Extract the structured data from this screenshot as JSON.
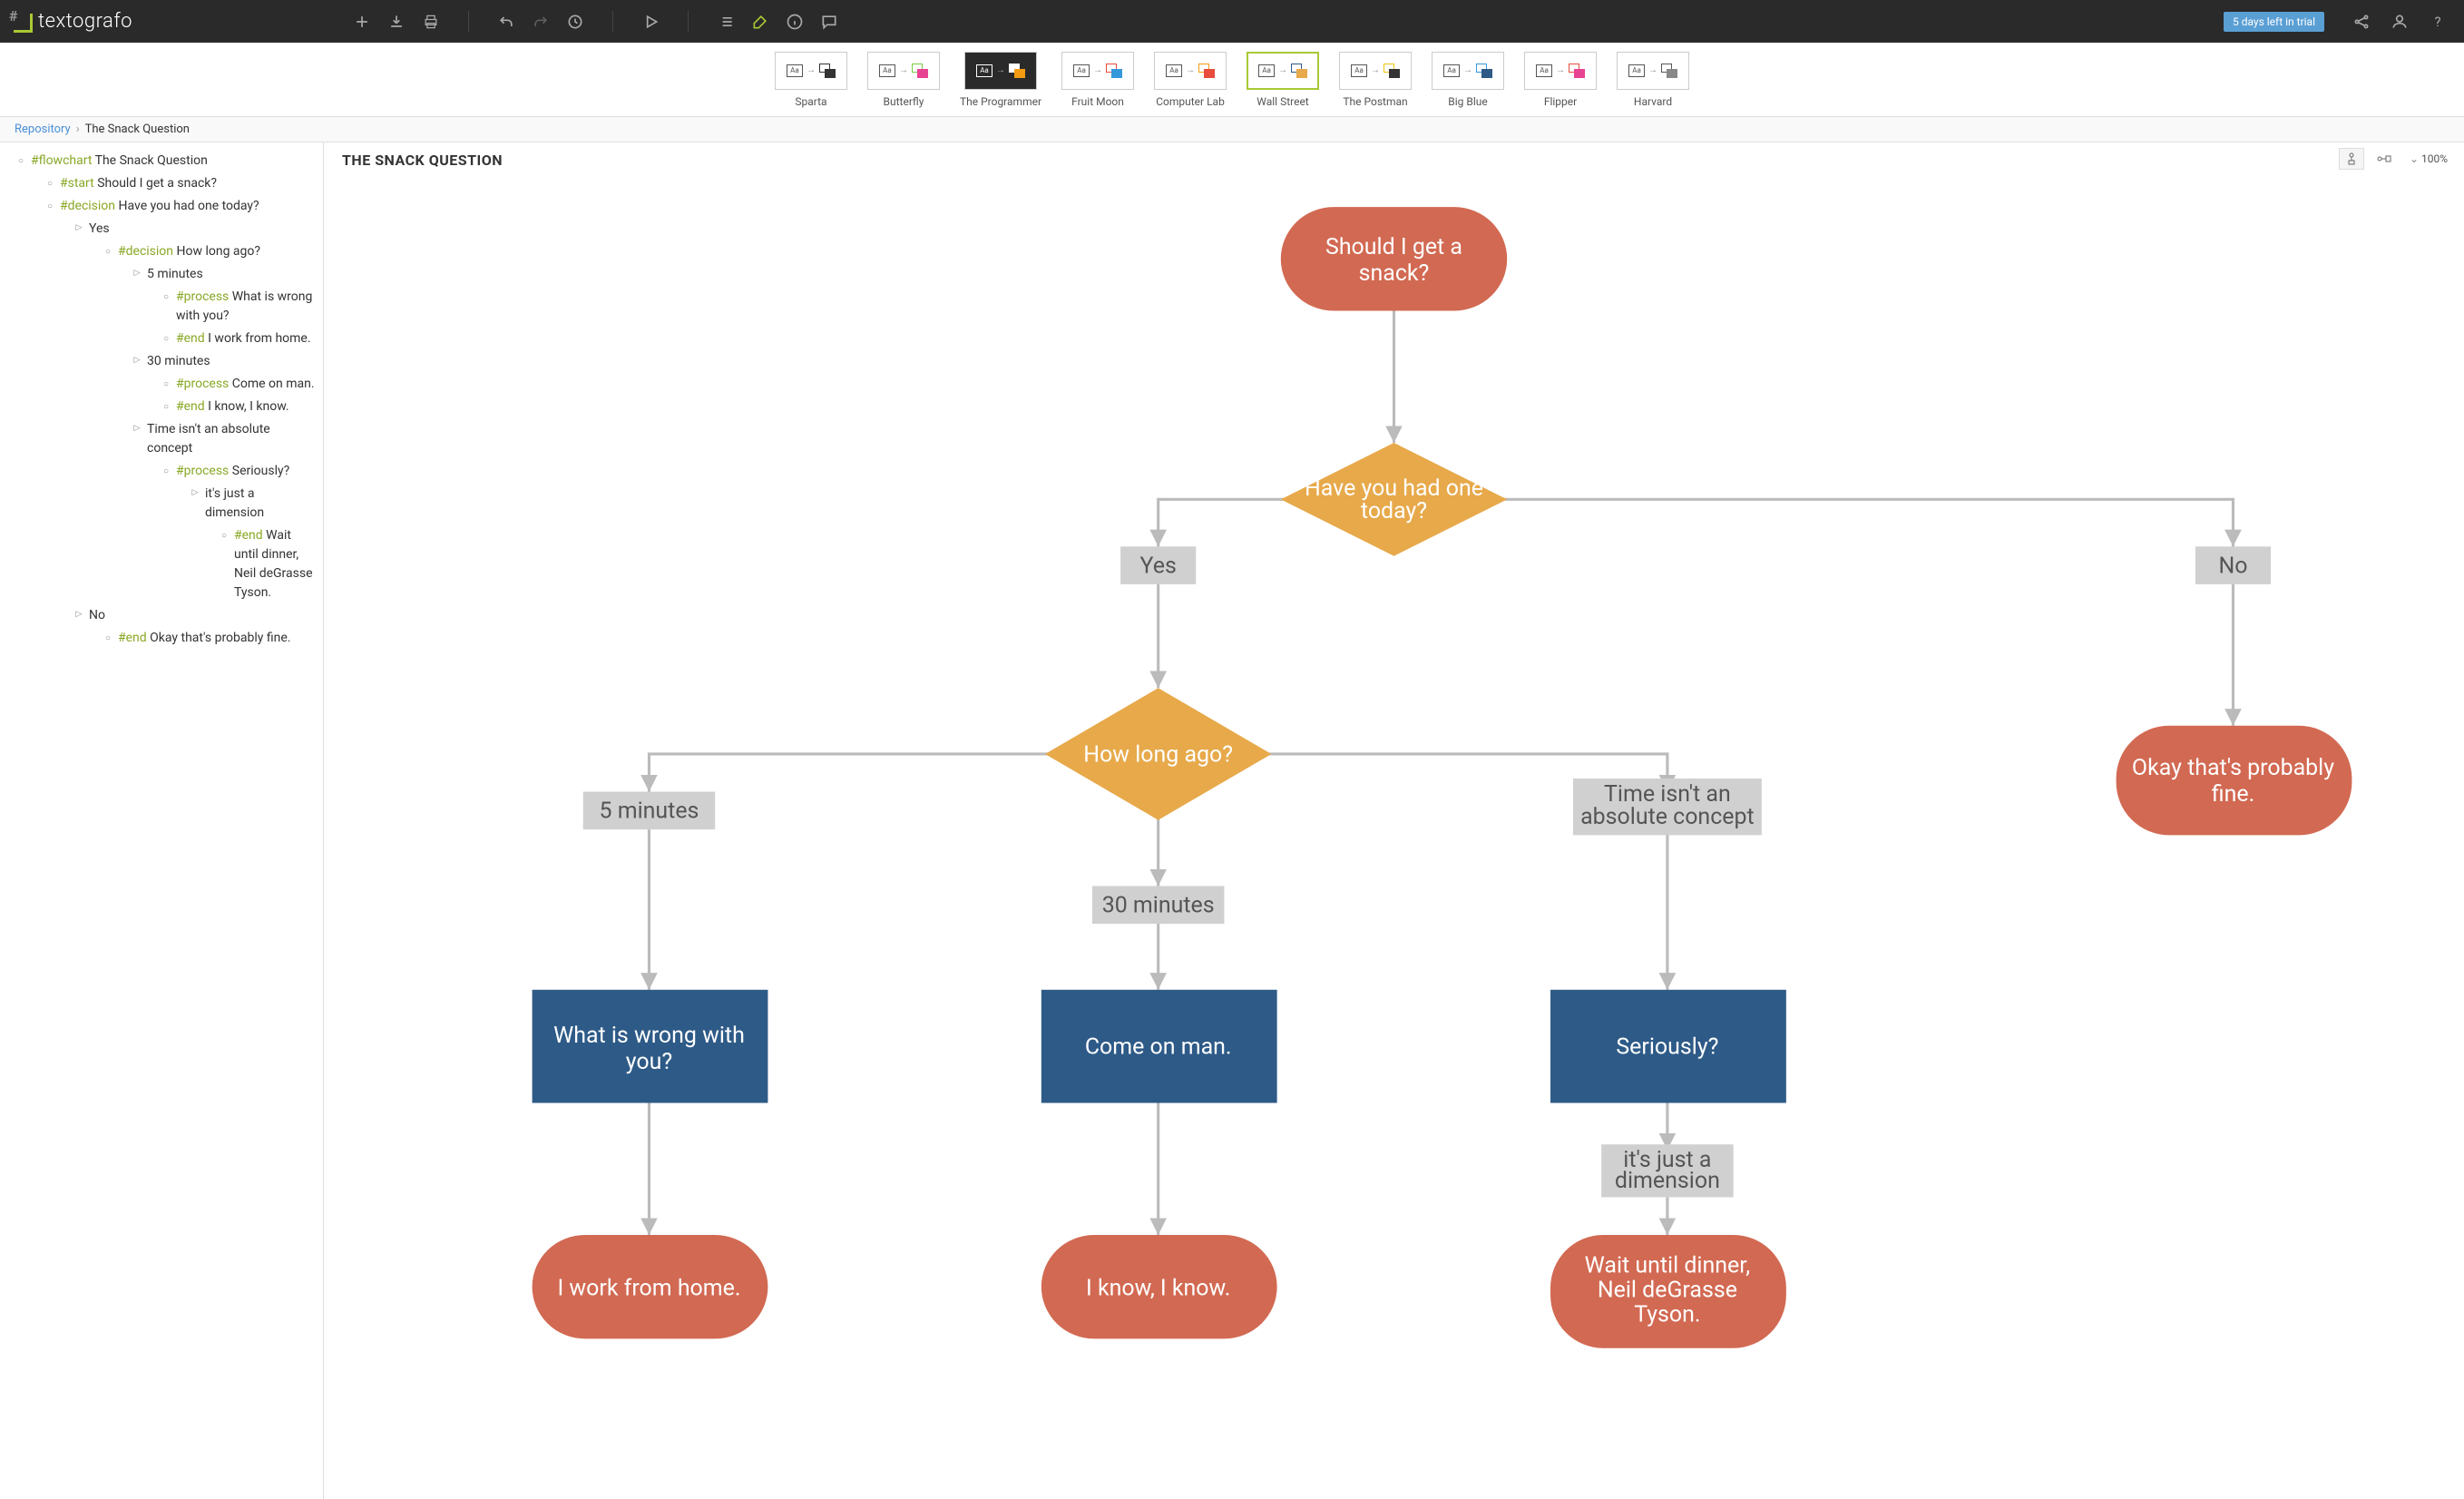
{
  "app": {
    "name": "textografo",
    "trial_text": "5 days left in trial"
  },
  "themes": [
    {
      "label": "Sparta",
      "dark": false,
      "selected": false,
      "c1": "#333",
      "c2": "#333"
    },
    {
      "label": "Butterfly",
      "dark": false,
      "selected": false,
      "c1": "#7ac943",
      "c2": "#e84393"
    },
    {
      "label": "The Programmer",
      "dark": true,
      "selected": false,
      "c1": "#fff",
      "c2": "#f39c12"
    },
    {
      "label": "Fruit Moon",
      "dark": false,
      "selected": false,
      "c1": "#e74c3c",
      "c2": "#3498db"
    },
    {
      "label": "Computer Lab",
      "dark": false,
      "selected": false,
      "c1": "#f39c12",
      "c2": "#e74c3c"
    },
    {
      "label": "Wall Street",
      "dark": false,
      "selected": true,
      "c1": "#2e5a87",
      "c2": "#e7a94a"
    },
    {
      "label": "The Postman",
      "dark": false,
      "selected": false,
      "c1": "#f1c40f",
      "c2": "#333"
    },
    {
      "label": "Big Blue",
      "dark": false,
      "selected": false,
      "c1": "#3498db",
      "c2": "#2e5a87"
    },
    {
      "label": "Flipper",
      "dark": false,
      "selected": false,
      "c1": "#e74c3c",
      "c2": "#e84393"
    },
    {
      "label": "Harvard",
      "dark": false,
      "selected": false,
      "c1": "#555",
      "c2": "#888"
    }
  ],
  "breadcrumb": {
    "root": "Repository",
    "current": "The Snack Question"
  },
  "tree": [
    {
      "indent": 0,
      "bullet": "circle",
      "tag": "#flowchart",
      "text": "The Snack Question"
    },
    {
      "indent": 1,
      "bullet": "circle",
      "tag": "#start",
      "text": "Should I get a snack?"
    },
    {
      "indent": 1,
      "bullet": "circle",
      "tag": "#decision",
      "text": "Have you had one today?"
    },
    {
      "indent": 2,
      "bullet": "arrow",
      "tag": "",
      "text": "Yes"
    },
    {
      "indent": 3,
      "bullet": "circle",
      "tag": "#decision",
      "text": "How long ago?"
    },
    {
      "indent": 4,
      "bullet": "arrow",
      "tag": "",
      "text": "5 minutes"
    },
    {
      "indent": 5,
      "bullet": "circle",
      "tag": "#process",
      "text": " What is wrong with you?"
    },
    {
      "indent": 5,
      "bullet": "circle",
      "tag": "#end",
      "text": "I work from home."
    },
    {
      "indent": 4,
      "bullet": "arrow",
      "tag": "",
      "text": "30 minutes"
    },
    {
      "indent": 5,
      "bullet": "circle",
      "tag": "#process",
      "text": "Come on man."
    },
    {
      "indent": 5,
      "bullet": "circle",
      "tag": "#end",
      "text": "I know, I know."
    },
    {
      "indent": 4,
      "bullet": "arrow",
      "tag": "",
      "text": "Time isn't an absolute concept"
    },
    {
      "indent": 5,
      "bullet": "circle",
      "tag": "#process",
      "text": "Seriously?"
    },
    {
      "indent": 6,
      "bullet": "arrow",
      "tag": "",
      "text": "it's just a dimension"
    },
    {
      "indent": 7,
      "bullet": "circle",
      "tag": "#end",
      "text": "Wait until dinner, Neil deGrasse Tyson."
    },
    {
      "indent": 2,
      "bullet": "arrow",
      "tag": "",
      "text": "No"
    },
    {
      "indent": 3,
      "bullet": "circle",
      "tag": "#end",
      "text": "Okay that's probably fine."
    }
  ],
  "canvas": {
    "title": "THE SNACK QUESTION",
    "zoom": "100%"
  },
  "flow": {
    "start": "Should I get a snack?",
    "d1": "Have you had one today?",
    "yes": "Yes",
    "no": "No",
    "d2": "How long ago?",
    "b5": "5 minutes",
    "b30": "30 minutes",
    "btime": "Time isn't an absolute concept",
    "p1": "What is wrong with you?",
    "p2": "Come on man.",
    "p3": "Seriously?",
    "e1": "I work from home.",
    "e2": "I know, I know.",
    "bdim": "it's just a dimension",
    "e3_l1": "Wait until dinner,",
    "e3_l2": "Neil deGrasse",
    "e3_l3": "Tyson.",
    "e4_l1": "Okay that's probably",
    "e4_l2": "fine."
  }
}
